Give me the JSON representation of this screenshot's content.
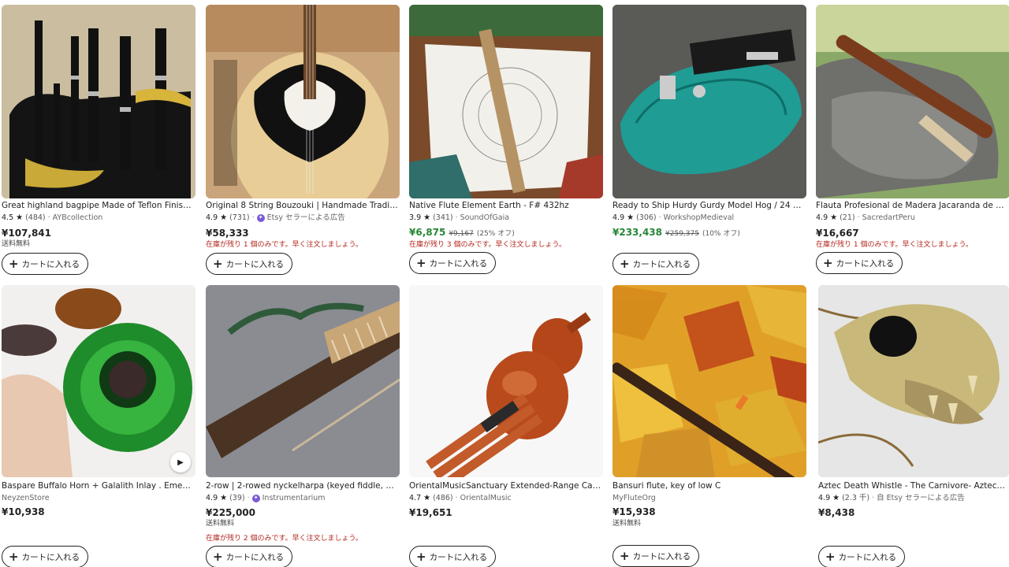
{
  "cart_label": "カートに入れる",
  "star_glyph": "★",
  "products": [
    {
      "title": "Great highland bagpipe Made of Teflon Finished Bl...",
      "rating": "4.5",
      "reviews": "(484)",
      "shop": "AYBcollection",
      "price": "¥107,841",
      "shipping": "送料無料"
    },
    {
      "title": "Original 8 String Bouzouki | Handmade Traditional ...",
      "rating": "4.9",
      "reviews": "(731)",
      "shop": "Etsy セラーによる広告",
      "price": "¥58,333",
      "stock": "在庫が残り 1 個のみです。早く注文しましょう。"
    },
    {
      "title": "Native Flute Element Earth - F# 432hz",
      "rating": "3.9",
      "reviews": "(341)",
      "shop": "SoundOfGaia",
      "price": "¥6,875",
      "original_price": "¥9,167",
      "discount": "(25% オフ)",
      "stock": "在庫が残り 3 個のみです。早く注文しましょう。"
    },
    {
      "title": "Ready to Ship Hurdy Gurdy Model Hog / 24 keys / ...",
      "rating": "4.9",
      "reviews": "(306)",
      "shop": "WorkshopMedieval",
      "price": "¥233,438",
      "original_price": "¥259,375",
      "discount": "(10% オフ)"
    },
    {
      "title": "Flauta Profesional de Madera Jacaranda de alta ...",
      "rating": "4.9",
      "reviews": "(21)",
      "shop": "SacredartPeru",
      "price": "¥16,667",
      "stock": "在庫が残り 1 個のみです。早く注文しましょう。"
    },
    {
      "title": "Baspare Buffalo Horn + Galalith Inlay . Emerald Gr...",
      "shop": "NeyzenStore",
      "price": "¥10,938"
    },
    {
      "title": "2-row | 2-rowed nyckelharpa (keyed fiddle, more ...",
      "rating": "4.9",
      "reviews": "(39)",
      "shop": "Instrumentarium",
      "price": "¥225,000",
      "shipping": "送料無料",
      "stock": "在庫が残り 2 個のみです。早く注文しましょう。"
    },
    {
      "title": "OrientalMusicSanctuary Extended-Range Came...",
      "rating": "4.7",
      "reviews": "(486)",
      "shop": "OrientalMusic",
      "price": "¥19,651"
    },
    {
      "title": "Bansuri flute, key of low C",
      "shop": "MyFluteOrg",
      "price": "¥15,938",
      "shipping": "送料無料"
    },
    {
      "title": "Aztec Death Whistle - The Carnivore- Aztec Deat...",
      "rating": "4.9",
      "reviews": "(2.3 千)",
      "shop": "自 Etsy セラーによる広告",
      "price": "¥8,438"
    }
  ],
  "icons": {
    "star": "star-icon",
    "badge": "etsy-seller-badge-icon",
    "play": "play-icon",
    "plus": "plus-icon"
  },
  "colors": {
    "sale_price": "#258635",
    "stock_warning": "#b3261e",
    "badge": "#7b5ad6"
  }
}
